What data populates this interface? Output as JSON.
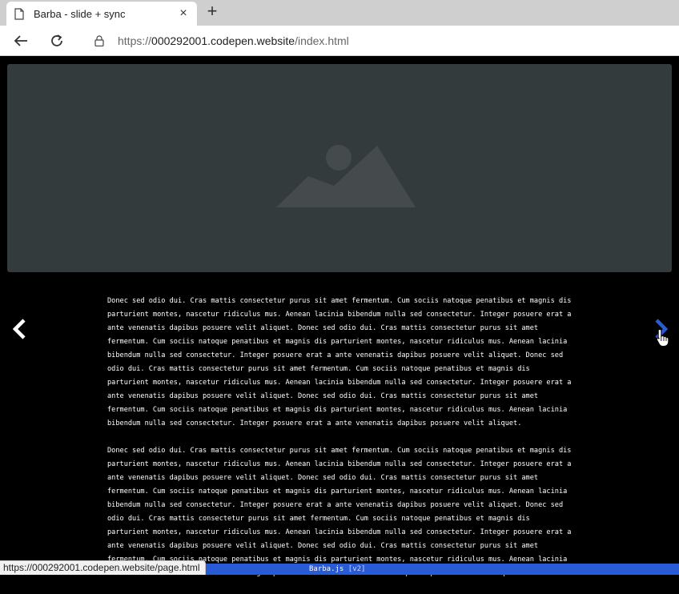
{
  "browser": {
    "tab_title": "Barba - slide + sync",
    "tab_close": "×",
    "new_tab": "+",
    "url_scheme": "https://",
    "url_host": "000292001.codepen.website",
    "url_path": "/index.html",
    "status_url": "https://000292001.codepen.website/page.html"
  },
  "page": {
    "paragraphs": [
      "Donec sed odio dui. Cras mattis consectetur purus sit amet fermentum. Cum sociis natoque penatibus et magnis dis parturient montes, nascetur ridiculus mus. Aenean lacinia bibendum nulla sed consectetur. Integer posuere erat a ante venenatis dapibus posuere velit aliquet. Donec sed odio dui. Cras mattis consectetur purus sit amet fermentum. Cum sociis natoque penatibus et magnis dis parturient montes, nascetur ridiculus mus. Aenean lacinia bibendum nulla sed consectetur. Integer posuere erat a ante venenatis dapibus posuere velit aliquet. Donec sed odio dui. Cras mattis consectetur purus sit amet fermentum. Cum sociis natoque penatibus et magnis dis parturient montes, nascetur ridiculus mus. Aenean lacinia bibendum nulla sed consectetur. Integer posuere erat a ante venenatis dapibus posuere velit aliquet. Donec sed odio dui. Cras mattis consectetur purus sit amet fermentum. Cum sociis natoque penatibus et magnis dis parturient montes, nascetur ridiculus mus. Aenean lacinia bibendum nulla sed consectetur. Integer posuere erat a ante venenatis dapibus posuere velit aliquet.",
      "Donec sed odio dui. Cras mattis consectetur purus sit amet fermentum. Cum sociis natoque penatibus et magnis dis parturient montes, nascetur ridiculus mus. Aenean lacinia bibendum nulla sed consectetur. Integer posuere erat a ante venenatis dapibus posuere velit aliquet. Donec sed odio dui. Cras mattis consectetur purus sit amet fermentum. Cum sociis natoque penatibus et magnis dis parturient montes, nascetur ridiculus mus. Aenean lacinia bibendum nulla sed consectetur. Integer posuere erat a ante venenatis dapibus posuere velit aliquet. Donec sed odio dui. Cras mattis consectetur purus sit amet fermentum. Cum sociis natoque penatibus et magnis dis parturient montes, nascetur ridiculus mus. Aenean lacinia bibendum nulla sed consectetur. Integer posuere erat a ante venenatis dapibus posuere velit aliquet. Donec sed odio dui. Cras mattis consectetur purus sit amet fermentum. Cum sociis natoque penatibus et magnis dis parturient montes, nascetur ridiculus mus. Aenean lacinia bibendum nulla sed consectetur. Integer posuere erat a ante venenatis dapibus posuere velit aliquet."
    ],
    "footer_name": "Barba.js",
    "footer_version": "[v2]",
    "icons": {
      "hero": "image-placeholder-icon",
      "prev": "chevron-left-icon",
      "next": "chevron-right-icon",
      "cursor": "hand-pointer-icon"
    }
  },
  "colors": {
    "page_bg": "#000000",
    "hero_bg": "#333b3c",
    "footer_bar": "#2a5bd7",
    "next_arrow": "#2a5bd7"
  }
}
